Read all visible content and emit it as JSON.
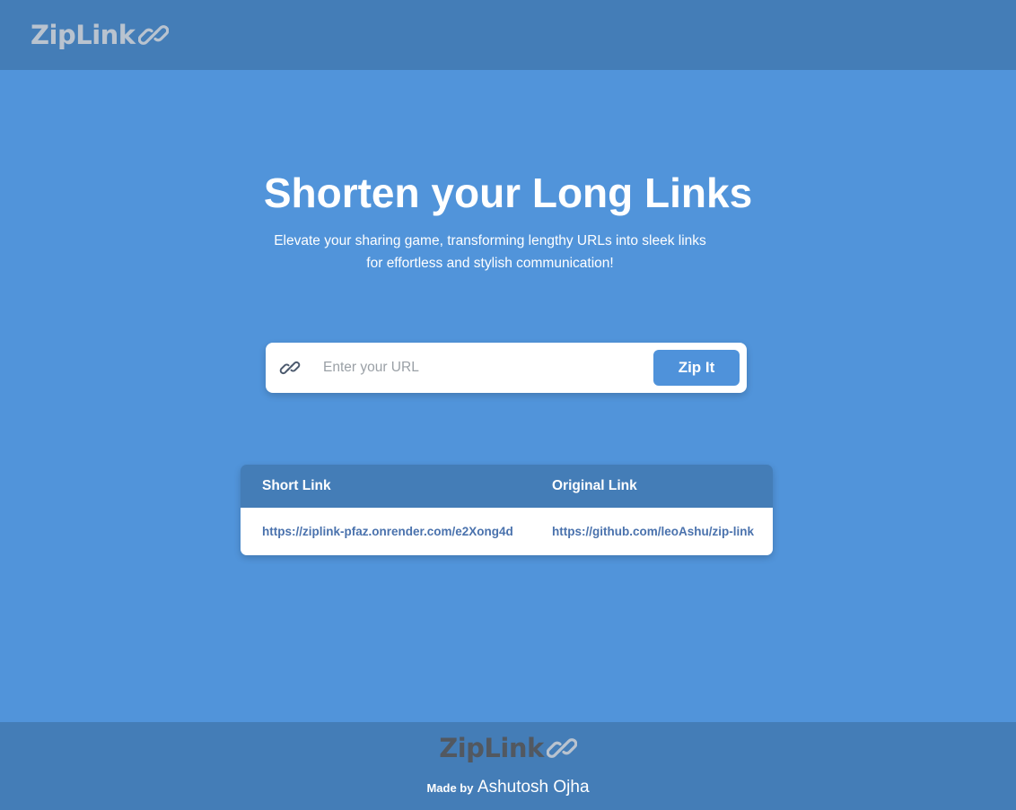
{
  "header": {
    "logo_text": "ZipLink",
    "logo_icon": "chain-link-icon"
  },
  "hero": {
    "title": "Shorten your Long Links",
    "subtitle": "Elevate your sharing game, transforming lengthy URLs into sleek links for effortless and stylish communication!"
  },
  "shortener": {
    "input_icon": "link-icon",
    "input_placeholder": "Enter your URL",
    "input_value": "",
    "button_label": "Zip It"
  },
  "table": {
    "columns": [
      "Short Link",
      "Original Link"
    ],
    "rows": [
      {
        "short": "https://ziplink-pfaz.onrender.com/e2Xong4d",
        "original": "https://github.com/leoAshu/zip-link"
      }
    ]
  },
  "footer": {
    "logo_text": "ZipLink",
    "made_by_label": "Made by",
    "author": "Ashutosh Ojha"
  },
  "colors": {
    "background": "#5194da",
    "header_footer": "#447db7",
    "button": "#4f92da",
    "link_text": "#4a72ad"
  }
}
